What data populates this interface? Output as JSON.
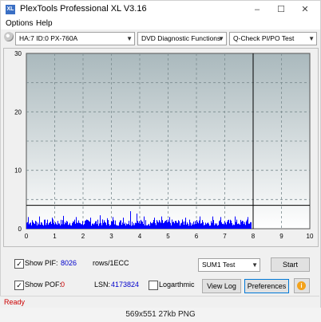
{
  "window": {
    "title": "PlexTools Professional XL V3.16",
    "icon_text": "XL",
    "controls": [
      "minimize-icon",
      "maximize-icon",
      "close-icon"
    ]
  },
  "menu": {
    "items": [
      {
        "label": "Options"
      },
      {
        "label": "Help"
      }
    ]
  },
  "toolbar": {
    "drive": "HA:7 ID:0  PX-760A",
    "function": "DVD Diagnostic Functions",
    "test": "Q-Check PI/PO Test"
  },
  "chart_data": {
    "type": "bar",
    "x_ticks": [
      "0",
      "1",
      "2",
      "3",
      "4",
      "5",
      "6",
      "7",
      "8",
      "9",
      "10"
    ],
    "y_ticks": [
      "0",
      "10",
      "20",
      "30"
    ],
    "xlim": [
      0,
      10
    ],
    "ylim": [
      0,
      30
    ],
    "threshold_line_y": 4,
    "marker_line_x": 8,
    "grid": true,
    "series": [
      {
        "color": "#0000ff",
        "x_start": 0,
        "x_end": 7.92,
        "baseline_range": [
          0.5,
          1.6
        ],
        "spikes": [
          [
            0.05,
            2.0
          ],
          [
            0.45,
            2.1
          ],
          [
            0.9,
            1.9
          ],
          [
            1.3,
            2.2
          ],
          [
            1.75,
            2.0
          ],
          [
            2.25,
            1.9
          ],
          [
            2.6,
            2.3
          ],
          [
            2.85,
            1.8
          ],
          [
            3.05,
            2.0
          ],
          [
            3.4,
            1.9
          ],
          [
            3.65,
            3.0
          ],
          [
            3.9,
            2.6
          ],
          [
            4.15,
            2.1
          ],
          [
            4.5,
            1.9
          ],
          [
            4.75,
            2.1
          ],
          [
            5.05,
            2.0
          ],
          [
            5.6,
            1.9
          ],
          [
            6.1,
            2.1
          ],
          [
            6.55,
            2.1
          ],
          [
            6.85,
            2.0
          ],
          [
            7.35,
            2.1
          ],
          [
            7.8,
            2.0
          ]
        ]
      }
    ],
    "colors": {
      "background_top": "#aab9bd",
      "background_bottom": "#ffffff",
      "grid": "#7a8a8e"
    }
  },
  "controls": {
    "pif": {
      "label": "Show PIF:",
      "checked": true,
      "value": "8026",
      "unit": "rows/1ECC"
    },
    "pof": {
      "label": "Show POF:",
      "checked": true,
      "value": "0"
    },
    "lsn": {
      "label": "LSN:",
      "value": "4173824"
    },
    "logarithmic": {
      "label": "Logarthmic",
      "checked": false
    },
    "sum_select": "SUM1 Test",
    "start_button": "Start",
    "viewlog_button": "View Log",
    "preferences_button": "Preferences",
    "info_button": "i"
  },
  "status": {
    "text": "Ready"
  },
  "caption": {
    "text": "569x551  27kb  PNG"
  }
}
